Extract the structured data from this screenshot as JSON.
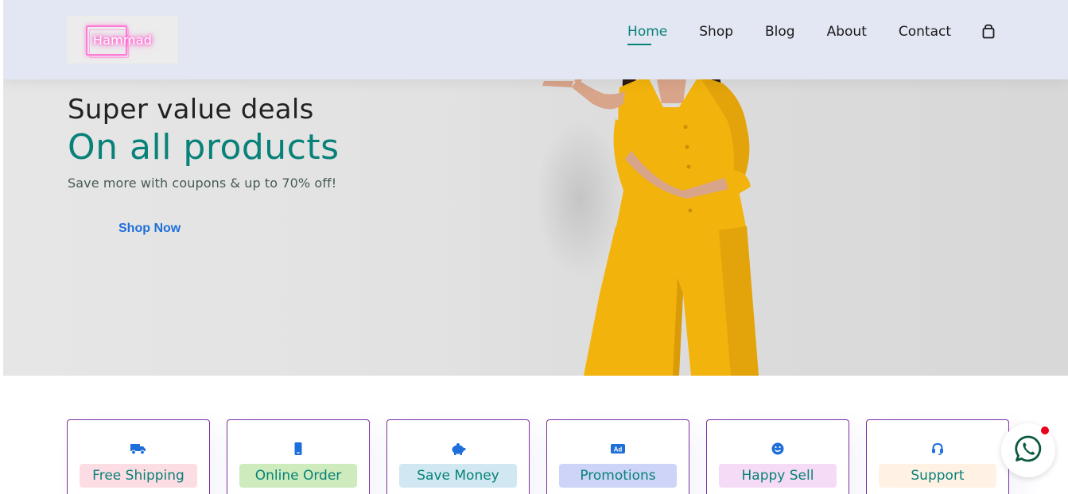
{
  "header": {
    "logo_text": "Hammad",
    "nav": [
      {
        "label": "Home",
        "active": true
      },
      {
        "label": "Shop"
      },
      {
        "label": "Blog"
      },
      {
        "label": "About"
      },
      {
        "label": "Contact"
      }
    ],
    "cart_icon": "shopping-bag-icon"
  },
  "hero": {
    "subheading": "Super value deals",
    "heading": "On all products",
    "description": "Save more with coupons & up to 70% off!",
    "button_label": "Shop Now"
  },
  "features": [
    {
      "label": "Free Shipping",
      "icon": "truck-icon",
      "bg": "#fddde4"
    },
    {
      "label": "Online Order",
      "icon": "mobile-icon",
      "bg": "#cdebbc"
    },
    {
      "label": "Save Money",
      "icon": "piggy-bank-icon",
      "bg": "#d1e8f2"
    },
    {
      "label": "Promotions",
      "icon": "ad-icon",
      "bg": "#cdd4f8"
    },
    {
      "label": "Happy Sell",
      "icon": "smile-icon",
      "bg": "#f6dbf6"
    },
    {
      "label": "Support",
      "icon": "headset-icon",
      "bg": "#fff2e5"
    }
  ],
  "colors": {
    "accent": "#088178",
    "header_bg": "#e3e6f3",
    "icon_blue": "#1e6fd9",
    "border": "#7b2ea0"
  },
  "floating": {
    "icon": "whatsapp-icon"
  }
}
